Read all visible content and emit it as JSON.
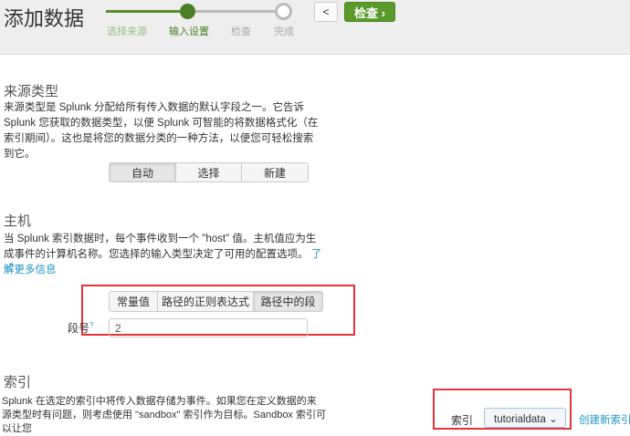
{
  "header": {
    "title": "添加数据",
    "steps": [
      "选择来源",
      "输入设置",
      "检查",
      "完成"
    ],
    "back_label": "<",
    "next_label": "检查 ›"
  },
  "sourcetype": {
    "heading": "来源类型",
    "desc": "来源类型是 Splunk 分配给所有传入数据的默认字段之一。它告诉 Splunk 您获取的数据类型，以便 Splunk 可智能的将数据格式化（在索引期间）。这也是将您的数据分类的一种方法，以便您可轻松搜索到它。",
    "buttons": [
      "自动",
      "选择",
      "新建"
    ]
  },
  "host": {
    "heading": "主机",
    "desc": "当 Splunk 索引数据时，每个事件收到一个 \"host\" 值。主机值应为生成事件的计算机名称。您选择的输入类型决定了可用的配置选项。",
    "learn_more": "了解更多信息",
    "buttons": [
      "常量值",
      "路径的正则表达式",
      "路径中的段"
    ],
    "segment_label": "段号",
    "segment_help": "?",
    "segment_value": "2"
  },
  "index": {
    "heading": "索引",
    "desc": "Splunk 在选定的索引中将传入数据存储为事件。如果您在定义数据的来源类型时有问题，则考虑使用 \"sandbox\" 索引作为目标。Sandbox 索引可以让您",
    "label": "索引",
    "value": "tutorialdata",
    "create_link": "创建新索引"
  },
  "colors": {
    "accent": "#5a9a2a",
    "red": "#e8323a",
    "link": "#1e93c6"
  }
}
